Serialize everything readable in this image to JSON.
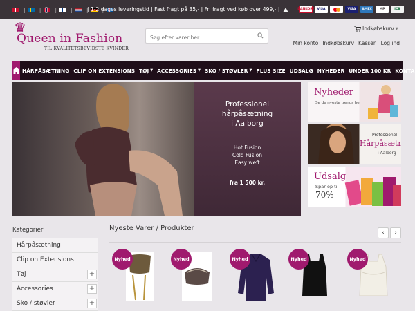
{
  "topbar": {
    "flags": [
      "dk",
      "se",
      "no",
      "fi",
      "nl",
      "de",
      "is"
    ],
    "info": "| 1-2 dages leveringstid | Fast fragt på 35,- | Fri fragt ved køb over 499,- |",
    "payments": [
      "DANKORT",
      "VISA",
      "MasterCard",
      "VISA",
      "AMEX",
      "MobilePay",
      "JCB"
    ]
  },
  "logo": {
    "title": "Queen in Fashion",
    "tagline": "TIL KVALITETSBEVIDSTE KVINDER"
  },
  "search": {
    "placeholder": "Søg efter varer her..."
  },
  "cart": {
    "label": "Indkøbskurv"
  },
  "account": {
    "links": [
      "Min konto",
      "Indkøbskurv",
      "Kassen",
      "Log ind"
    ]
  },
  "nav": {
    "items": [
      {
        "label": "HÅRPÅSÆTNING",
        "caret": false
      },
      {
        "label": "CLIP ON EXTENSIONS",
        "caret": false
      },
      {
        "label": "TØJ",
        "caret": true
      },
      {
        "label": "ACCESSORIES",
        "caret": true
      },
      {
        "label": "SKO / STØVLER",
        "caret": true
      },
      {
        "label": "PLUS SIZE",
        "caret": false
      },
      {
        "label": "UDSALG",
        "caret": false
      },
      {
        "label": "NYHEDER",
        "caret": false
      },
      {
        "label": "UNDER 100 KR",
        "caret": false
      }
    ],
    "contact": "KONTAKT OS"
  },
  "hero": {
    "title_line1": "Professionel",
    "title_line2": "hårpåsætning",
    "title_line3": "i Aalborg",
    "list": [
      "Hot Fusion",
      "Cold Fusion",
      "Easy weft"
    ],
    "price": "fra 1 500 kr."
  },
  "banners": {
    "b1_title": "Nyheder",
    "b1_sub": "Se de nyeste trends her",
    "b2_title_small": "Professionel",
    "b2_title": "Hårpåsætning",
    "b2_sub": "i Aalborg",
    "b3_title": "Udsalg",
    "b3_sub": "Spar op til",
    "b3_pct": "70%"
  },
  "sidebar": {
    "heading": "Kategorier",
    "items": [
      {
        "label": "Hårpåsætning",
        "expandable": false
      },
      {
        "label": "Clip on Extensions",
        "expandable": false
      },
      {
        "label": "Tøj",
        "expandable": true
      },
      {
        "label": "Accessories",
        "expandable": true
      },
      {
        "label": "Sko / støvler",
        "expandable": true
      }
    ]
  },
  "products": {
    "heading": "Nyeste Varer / Produkter",
    "badge": "Nyhed",
    "prev": "‹",
    "next": "›"
  },
  "colors": {
    "brand": "#a01a6e",
    "nav_bg": "#1f0e19",
    "topbar_bg": "#3a3338"
  }
}
